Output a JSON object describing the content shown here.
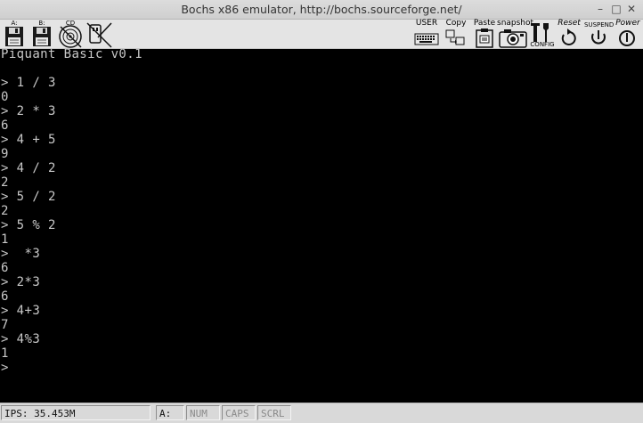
{
  "window": {
    "title": "Bochs x86 emulator, http://bochs.sourceforge.net/",
    "minimize_glyph": "–",
    "maximize_glyph": "□",
    "close_glyph": "✕"
  },
  "toolbar": {
    "floppy_a": {
      "label": "A:",
      "icon": "floppy-disk-icon"
    },
    "floppy_b": {
      "label": "B:",
      "icon": "floppy-disk-icon"
    },
    "cdrom": {
      "label": "CD",
      "icon": "cdrom-icon"
    },
    "usb": {
      "label": "",
      "icon": "usb-drive-icon"
    },
    "user": {
      "label": "USER",
      "icon": "keyboard-icon"
    },
    "copy": {
      "label": "Copy",
      "icon": "copy-icon"
    },
    "paste": {
      "label": "Paste",
      "icon": "paste-icon"
    },
    "snapshot": {
      "label": "snapshot",
      "icon": "camera-icon"
    },
    "config": {
      "label": "CONFIG",
      "icon": "config-icon"
    },
    "reset": {
      "label": "Reset",
      "icon": "reset-icon"
    },
    "suspend": {
      "label": "SUSPEND",
      "icon": "suspend-icon"
    },
    "power": {
      "label": "Power",
      "icon": "power-icon"
    }
  },
  "terminal": {
    "lines": [
      "Piquant Basic v0.1",
      "",
      "> 1 / 3",
      "0",
      "> 2 * 3",
      "6",
      "> 4 + 5",
      "9",
      "> 4 / 2",
      "2",
      "> 5 / 2",
      "2",
      "> 5 % 2",
      "1",
      ">  *3",
      "6",
      "> 2*3",
      "6",
      "> 4+3",
      "7",
      "> 4%3",
      "1",
      ">"
    ]
  },
  "statusbar": {
    "ips": "IPS: 35.453M",
    "drive": "A:",
    "num": "NUM",
    "caps": "CAPS",
    "scrl": "SCRL"
  }
}
